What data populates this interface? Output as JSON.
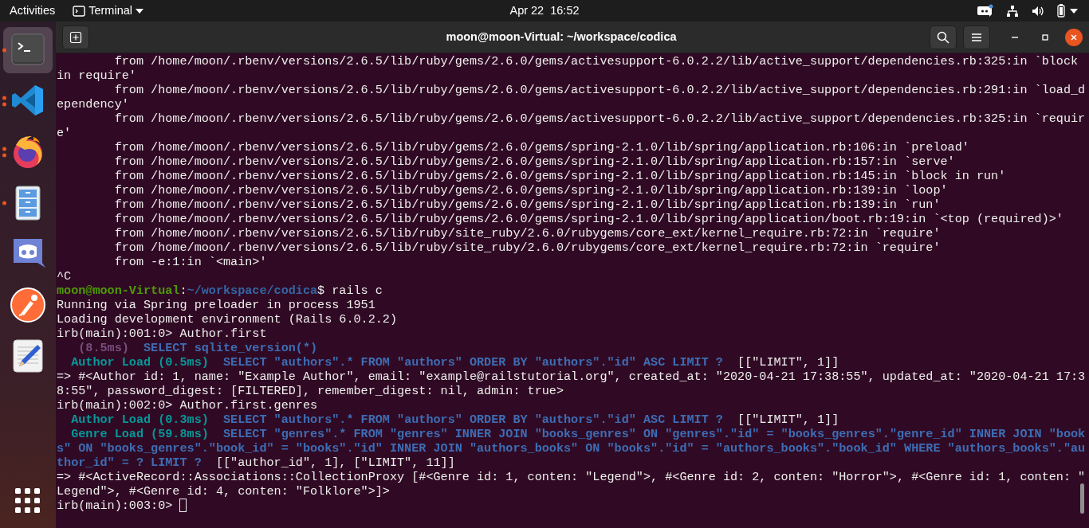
{
  "top_bar": {
    "activities": "Activities",
    "app_menu": "Terminal",
    "clock": "Apr 22  16:52"
  },
  "dock": {
    "apps": [
      {
        "kind": "terminal",
        "selected": true,
        "running": true,
        "multiple_windows": false
      },
      {
        "kind": "code-editor",
        "selected": false,
        "running": true,
        "multiple_windows": true
      },
      {
        "kind": "browser",
        "selected": false,
        "running": true,
        "multiple_windows": true
      },
      {
        "kind": "file-cabinet",
        "selected": false,
        "running": true,
        "multiple_windows": false
      },
      {
        "kind": "chat",
        "selected": false,
        "running": false
      },
      {
        "kind": "rocket-person",
        "selected": false,
        "running": false
      },
      {
        "kind": "text-editor",
        "selected": false,
        "running": false
      }
    ]
  },
  "window": {
    "title": "moon@moon-Virtual: ~/workspace/codica",
    "lines": [
      {
        "segments": [
          {
            "kind": "plain",
            "text": "        from /home/moon/.rbenv/versions/2.6.5/lib/ruby/gems/2.6.0/gems/activesupport-6.0.2.2/lib/active_support/dependencies.rb:325:in `block"
          }
        ]
      },
      {
        "segments": [
          {
            "kind": "plain",
            "text": "in require'"
          }
        ]
      },
      {
        "segments": [
          {
            "kind": "plain",
            "text": "        from /home/moon/.rbenv/versions/2.6.5/lib/ruby/gems/2.6.0/gems/activesupport-6.0.2.2/lib/active_support/dependencies.rb:291:in `load_d"
          }
        ]
      },
      {
        "segments": [
          {
            "kind": "plain",
            "text": "ependency'"
          }
        ]
      },
      {
        "segments": [
          {
            "kind": "plain",
            "text": "        from /home/moon/.rbenv/versions/2.6.5/lib/ruby/gems/2.6.0/gems/activesupport-6.0.2.2/lib/active_support/dependencies.rb:325:in `requir"
          }
        ]
      },
      {
        "segments": [
          {
            "kind": "plain",
            "text": "e'"
          }
        ]
      },
      {
        "segments": [
          {
            "kind": "plain",
            "text": "        from /home/moon/.rbenv/versions/2.6.5/lib/ruby/gems/2.6.0/gems/spring-2.1.0/lib/spring/application.rb:106:in `preload'"
          }
        ]
      },
      {
        "segments": [
          {
            "kind": "plain",
            "text": "        from /home/moon/.rbenv/versions/2.6.5/lib/ruby/gems/2.6.0/gems/spring-2.1.0/lib/spring/application.rb:157:in `serve'"
          }
        ]
      },
      {
        "segments": [
          {
            "kind": "plain",
            "text": "        from /home/moon/.rbenv/versions/2.6.5/lib/ruby/gems/2.6.0/gems/spring-2.1.0/lib/spring/application.rb:145:in `block in run'"
          }
        ]
      },
      {
        "segments": [
          {
            "kind": "plain",
            "text": "        from /home/moon/.rbenv/versions/2.6.5/lib/ruby/gems/2.6.0/gems/spring-2.1.0/lib/spring/application.rb:139:in `loop'"
          }
        ]
      },
      {
        "segments": [
          {
            "kind": "plain",
            "text": "        from /home/moon/.rbenv/versions/2.6.5/lib/ruby/gems/2.6.0/gems/spring-2.1.0/lib/spring/application.rb:139:in `run'"
          }
        ]
      },
      {
        "segments": [
          {
            "kind": "plain",
            "text": "        from /home/moon/.rbenv/versions/2.6.5/lib/ruby/gems/2.6.0/gems/spring-2.1.0/lib/spring/application/boot.rb:19:in `<top (required)>'"
          }
        ]
      },
      {
        "segments": [
          {
            "kind": "plain",
            "text": "        from /home/moon/.rbenv/versions/2.6.5/lib/ruby/site_ruby/2.6.0/rubygems/core_ext/kernel_require.rb:72:in `require'"
          }
        ]
      },
      {
        "segments": [
          {
            "kind": "plain",
            "text": "        from /home/moon/.rbenv/versions/2.6.5/lib/ruby/site_ruby/2.6.0/rubygems/core_ext/kernel_require.rb:72:in `require'"
          }
        ]
      },
      {
        "segments": [
          {
            "kind": "plain",
            "text": "        from -e:1:in `<main>'"
          }
        ]
      },
      {
        "segments": [
          {
            "kind": "plain",
            "text": "^C"
          }
        ]
      },
      {
        "segments": [
          {
            "kind": "user",
            "text": "moon@moon-Virtual"
          },
          {
            "kind": "plain",
            "text": ":"
          },
          {
            "kind": "path",
            "text": "~/workspace/codica"
          },
          {
            "kind": "plain",
            "text": "$ rails c"
          }
        ]
      },
      {
        "segments": [
          {
            "kind": "plain",
            "text": "Running via Spring preloader in process 1951"
          }
        ]
      },
      {
        "segments": [
          {
            "kind": "plain",
            "text": "Loading development environment (Rails 6.0.2.2)"
          }
        ]
      },
      {
        "segments": [
          {
            "kind": "plain",
            "text": "irb(main):001:0> Author.first"
          }
        ]
      },
      {
        "segments": [
          {
            "kind": "timing",
            "text": "   (8.5ms)"
          },
          {
            "kind": "sql",
            "text": "  SELECT sqlite_version(*)"
          }
        ]
      },
      {
        "segments": [
          {
            "kind": "label",
            "text": "  Author Load (0.5ms)"
          },
          {
            "kind": "sql",
            "text": "  SELECT \"authors\".* FROM \"authors\" ORDER BY \"authors\".\"id\" ASC LIMIT ?"
          },
          {
            "kind": "plain",
            "text": "  [[\"LIMIT\", 1]]"
          }
        ]
      },
      {
        "segments": [
          {
            "kind": "plain",
            "text": "=> #<Author id: 1, name: \"Example Author\", email: \"example@railstutorial.org\", created_at: \"2020-04-21 17:38:55\", updated_at: \"2020-04-21 17:3"
          }
        ]
      },
      {
        "segments": [
          {
            "kind": "plain",
            "text": "8:55\", password_digest: [FILTERED], remember_digest: nil, admin: true>"
          }
        ]
      },
      {
        "segments": [
          {
            "kind": "plain",
            "text": "irb(main):002:0> Author.first.genres"
          }
        ]
      },
      {
        "segments": [
          {
            "kind": "label",
            "text": "  Author Load (0.3ms)"
          },
          {
            "kind": "sql",
            "text": "  SELECT \"authors\".* FROM \"authors\" ORDER BY \"authors\".\"id\" ASC LIMIT ?"
          },
          {
            "kind": "plain",
            "text": "  [[\"LIMIT\", 1]]"
          }
        ]
      },
      {
        "segments": [
          {
            "kind": "label",
            "text": "  Genre Load (59.8ms)"
          },
          {
            "kind": "sql",
            "text": "  SELECT \"genres\".* FROM \"genres\" INNER JOIN \"books_genres\" ON \"genres\".\"id\" = \"books_genres\".\"genre_id\" INNER JOIN \"book"
          }
        ]
      },
      {
        "segments": [
          {
            "kind": "sql",
            "text": "s\" ON \"books_genres\".\"book_id\" = \"books\".\"id\" INNER JOIN \"authors_books\" ON \"books\".\"id\" = \"authors_books\".\"book_id\" WHERE \"authors_books\".\"au"
          }
        ]
      },
      {
        "segments": [
          {
            "kind": "sql",
            "text": "thor_id\" = ? LIMIT ?"
          },
          {
            "kind": "plain",
            "text": "  [[\"author_id\", 1], [\"LIMIT\", 11]]"
          }
        ]
      },
      {
        "segments": [
          {
            "kind": "plain",
            "text": "=> #<ActiveRecord::Associations::CollectionProxy [#<Genre id: 1, conten: \"Legend\">, #<Genre id: 2, conten: \"Horror\">, #<Genre id: 1, conten: \""
          }
        ]
      },
      {
        "segments": [
          {
            "kind": "plain",
            "text": "Legend\">, #<Genre id: 4, conten: \"Folklore\">]>"
          }
        ]
      },
      {
        "segments": [
          {
            "kind": "plain",
            "text": "irb(main):003:0> "
          }
        ],
        "cursor": true
      }
    ]
  }
}
